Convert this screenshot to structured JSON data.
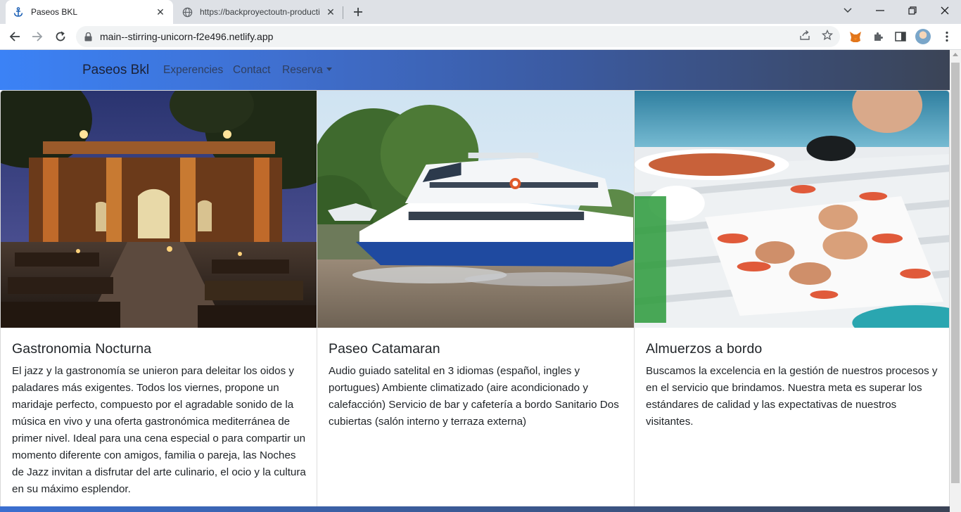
{
  "browser": {
    "tabs": [
      {
        "title": "Paseos BKL",
        "icon": "anchor-icon",
        "active": true
      },
      {
        "title": "https://backproyectoutn-producti",
        "icon": "globe-icon",
        "active": false
      }
    ],
    "url": "main--stirring-unicorn-f2e496.netlify.app"
  },
  "navbar": {
    "brand": "Paseos Bkl",
    "links": [
      "Experencies",
      "Contact"
    ],
    "dropdown": "Reserva"
  },
  "cards": [
    {
      "title": "Gastronomia Nocturna",
      "text": "El jazz y la gastronomía se unieron para deleitar los oidos y paladares más exigentes. Todos los viernes, propone un maridaje perfecto, compuesto por el agradable sonido de la música en vivo y una oferta gastronómica mediterránea de primer nivel. Ideal para una cena especial o para compartir un momento diferente con amigos, familia o pareja, las Noches de Jazz invitan a disfrutar del arte culinario, el ocio y la cultura en su máximo esplendor.",
      "image": "night-restaurant-photo"
    },
    {
      "title": "Paseo Catamaran",
      "text": "Audio guiado satelital en 3 idiomas (español, ingles y portugues) Ambiente climatizado (aire acondicionado y calefacción) Servicio de bar y cafetería a bordo Sanitario Dos cubiertas (salón interno y terraza externa)",
      "image": "catamaran-boat-photo"
    },
    {
      "title": "Almuerzos a bordo",
      "text": "Buscamos la excelencia en la gestión de nuestros procesos y en el servicio que brindamos. Nuestra meta es superar los estándares de calidad y las expectativas de nuestros visitantes.",
      "image": "seafood-lunch-photo"
    }
  ],
  "colors": {
    "navbar_start": "#3b82f6",
    "navbar_end": "#3b4456",
    "text": "#212529"
  }
}
